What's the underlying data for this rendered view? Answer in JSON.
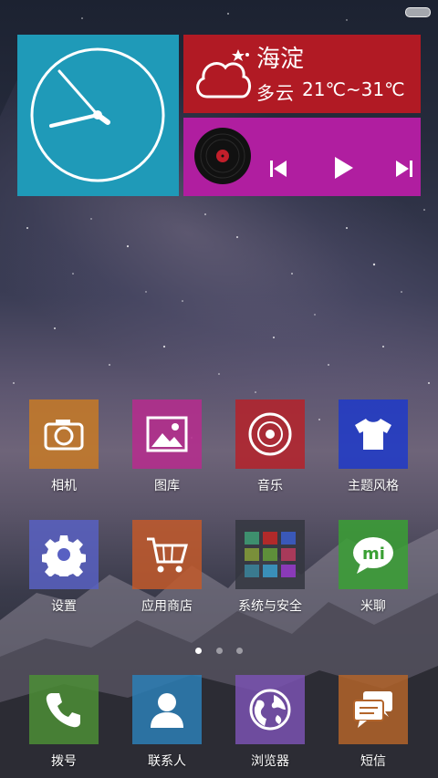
{
  "weather": {
    "city": "海淀",
    "condition": "多云",
    "temperature": "21℃~31℃",
    "icon": "cloud-moon-icon"
  },
  "clock": {
    "icon": "analog-clock"
  },
  "music": {
    "album_icon": "vinyl-record-icon",
    "prev_icon": "skip-previous-icon",
    "play_icon": "play-icon",
    "next_icon": "skip-next-icon"
  },
  "apps_row1": [
    {
      "label": "相机",
      "icon": "camera-icon",
      "color": "#c87a26"
    },
    {
      "label": "图库",
      "icon": "gallery-icon",
      "color": "#b72c8e"
    },
    {
      "label": "音乐",
      "icon": "music-disc-icon",
      "color": "#b5222a"
    },
    {
      "label": "主题风格",
      "icon": "tshirt-icon",
      "color": "#1f39c9"
    }
  ],
  "apps_row2": [
    {
      "label": "设置",
      "icon": "gear-icon",
      "color": "#5860c2"
    },
    {
      "label": "应用商店",
      "icon": "shopping-cart-icon",
      "color": "#c2592a"
    },
    {
      "label": "系统与安全",
      "icon": "folder-icon",
      "color": "#34363f"
    },
    {
      "label": "米聊",
      "icon": "mi-chat-icon",
      "color": "#3aa034"
    }
  ],
  "dock": [
    {
      "label": "拨号",
      "icon": "phone-icon",
      "color": "#4c8e36"
    },
    {
      "label": "联系人",
      "icon": "contact-icon",
      "color": "#2d7fb6"
    },
    {
      "label": "浏览器",
      "icon": "globe-icon",
      "color": "#7a52b2"
    },
    {
      "label": "短信",
      "icon": "message-icon",
      "color": "#b3642a"
    }
  ],
  "page_indicator": {
    "pages": 3,
    "current": 1
  },
  "colors": {
    "clock_tile": "#1f9ab8",
    "weather_tile": "#b11a24",
    "music_tile": "#b01ea0"
  }
}
